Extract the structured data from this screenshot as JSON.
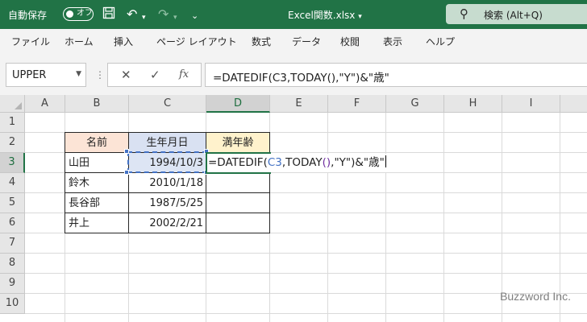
{
  "titlebar": {
    "autosave_label": "自動保存",
    "autosave_toggle": "オフ",
    "filename": "Excel関数.xlsx",
    "search_label": "検索 (Alt+Q)"
  },
  "ribbon": {
    "tabs": [
      "ファイル",
      "ホーム",
      "挿入",
      "ページ レイアウト",
      "数式",
      "データ",
      "校閲",
      "表示",
      "ヘルプ"
    ]
  },
  "formula_bar": {
    "name_box": "UPPER",
    "formula": "=DATEDIF(C3,TODAY(),\"Y\")&\"歳\"",
    "fx_label": "fx"
  },
  "columns": [
    "A",
    "B",
    "C",
    "D",
    "E",
    "F",
    "G",
    "H",
    "I"
  ],
  "rows": [
    "1",
    "2",
    "3",
    "4",
    "5",
    "6",
    "7",
    "8",
    "9",
    "10"
  ],
  "table": {
    "headers": [
      "名前",
      "生年月日",
      "満年齢"
    ],
    "names": [
      "山田",
      "鈴木",
      "長谷部",
      "井上"
    ],
    "dates": [
      "1994/10/3",
      "2010/1/18",
      "1987/5/25",
      "2002/2/21"
    ]
  },
  "edit_cell": {
    "part1": "=DATEDIF(",
    "ref": "C3",
    "part2": ",TODAY",
    "paren": "()",
    "part3": ",\"Y\")&\"歳\""
  },
  "watermark": "Buzzword Inc.",
  "colors": {
    "excel_green": "#217346",
    "header_name_bg": "#fce4d6",
    "header_date_bg": "#d9e1f2",
    "header_age_bg": "#fff2cc",
    "selected_date_bg": "#dde5f4",
    "ref_blue": "#4472c4",
    "paren_purple": "#7030a0"
  }
}
